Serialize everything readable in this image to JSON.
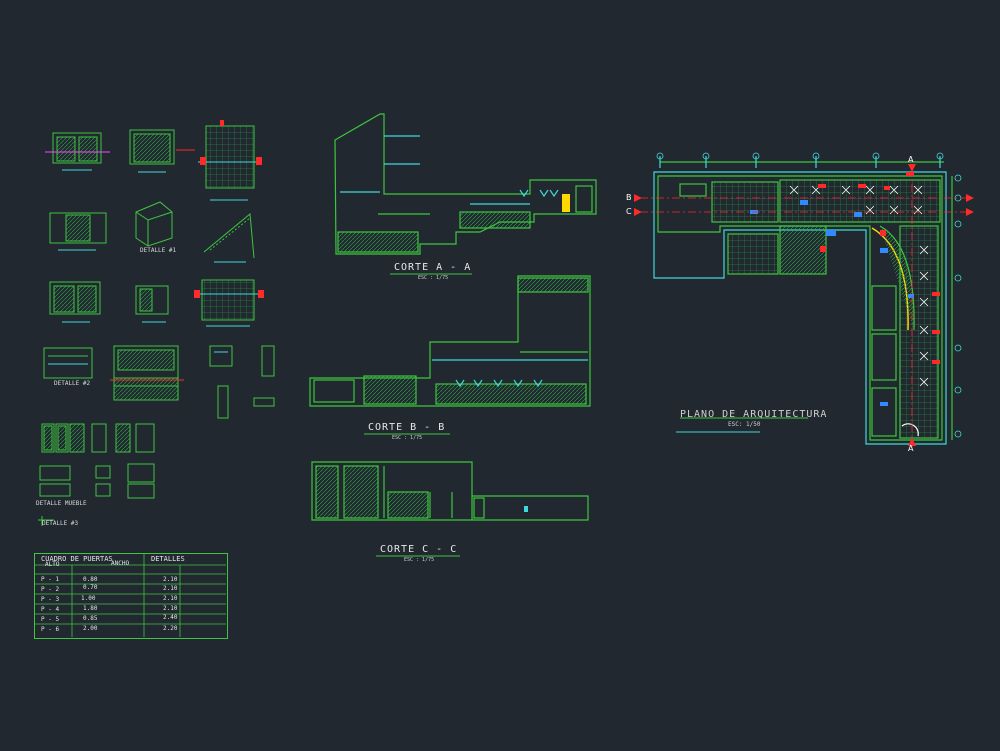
{
  "sections": {
    "corte_a": {
      "title": "CORTE  A - A",
      "scale": "ESC : 1/75"
    },
    "corte_b": {
      "title": "CORTE  B - B",
      "scale": "ESC : 1/75"
    },
    "corte_c": {
      "title": "CORTE  C - C",
      "scale": "ESC : 1/75"
    },
    "plano": {
      "title": "PLANO DE ARQUITECTURA",
      "scale": "ESC: 1/50"
    }
  },
  "details": {
    "detalle_1": "DETALLE #1",
    "detalle_2": "DETALLE #2",
    "detalle_mueble": "DETALLE MUEBLE",
    "detalle_3": "DETALLE #3"
  },
  "axis_marks": {
    "a": "A",
    "b": "B",
    "c": "C"
  },
  "door_table": {
    "title": "CUADRO DE PUERTAS",
    "details_header": "DETALLES",
    "col_alto": "ALTO",
    "col_ancho": "ANCHO",
    "rows": [
      {
        "id": "P - 1",
        "ancho": "0.80",
        "alto": "2.10"
      },
      {
        "id": "P - 2",
        "ancho": "0.70",
        "alto": "2.10"
      },
      {
        "id": "P - 3",
        "ancho": "1.00",
        "alto": "2.10"
      },
      {
        "id": "P - 4",
        "ancho": "1.80",
        "alto": "2.10"
      },
      {
        "id": "P - 5",
        "ancho": "0.85",
        "alto": "2.40"
      },
      {
        "id": "P - 6",
        "ancho": "2.00",
        "alto": "2.20"
      }
    ]
  },
  "colors": {
    "background": "#212830",
    "line_green": "#3fc53f",
    "line_cyan": "#3fd9d9",
    "accent_red": "#ff2a2a",
    "accent_yellow": "#ffd800",
    "accent_blue": "#2f8bff",
    "accent_magenta": "#ff40ff"
  }
}
